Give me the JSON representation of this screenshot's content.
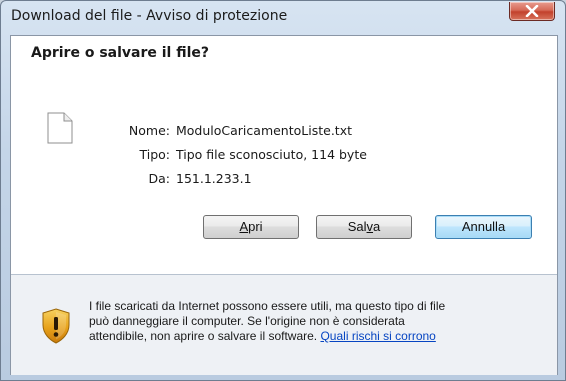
{
  "window": {
    "title": "Download del file - Avviso di protezione"
  },
  "dialog": {
    "heading": "Aprire o salvare il file?",
    "fields": [
      {
        "label": "Nome:",
        "value": "ModuloCaricamentoListe.txt"
      },
      {
        "label": "Tipo:",
        "value": "Tipo file sconosciuto, 114 byte"
      },
      {
        "label": "Da:",
        "value": "151.1.233.1"
      }
    ],
    "buttons": {
      "open": {
        "pre": "",
        "mnemonic": "A",
        "post": "pri"
      },
      "save": {
        "pre": "Sal",
        "mnemonic": "v",
        "post": "a"
      },
      "cancel": "Annulla"
    },
    "warning": {
      "lines": [
        "I file scaricati da Internet possono essere utili, ma questo tipo di file",
        "può danneggiare il computer. Se l'origine non è considerata",
        "attendibile, non aprire o salvare il software."
      ],
      "link": "Quali rischi si corrono"
    }
  },
  "icons": {
    "close": "close-icon",
    "file": "generic-file-icon",
    "shield": "security-warning-shield-icon"
  },
  "colors": {
    "link": "#0645c2",
    "close_button": "#c2412c",
    "default_button_border": "#3c7fb1",
    "warning_shield": "#e8a21a"
  }
}
